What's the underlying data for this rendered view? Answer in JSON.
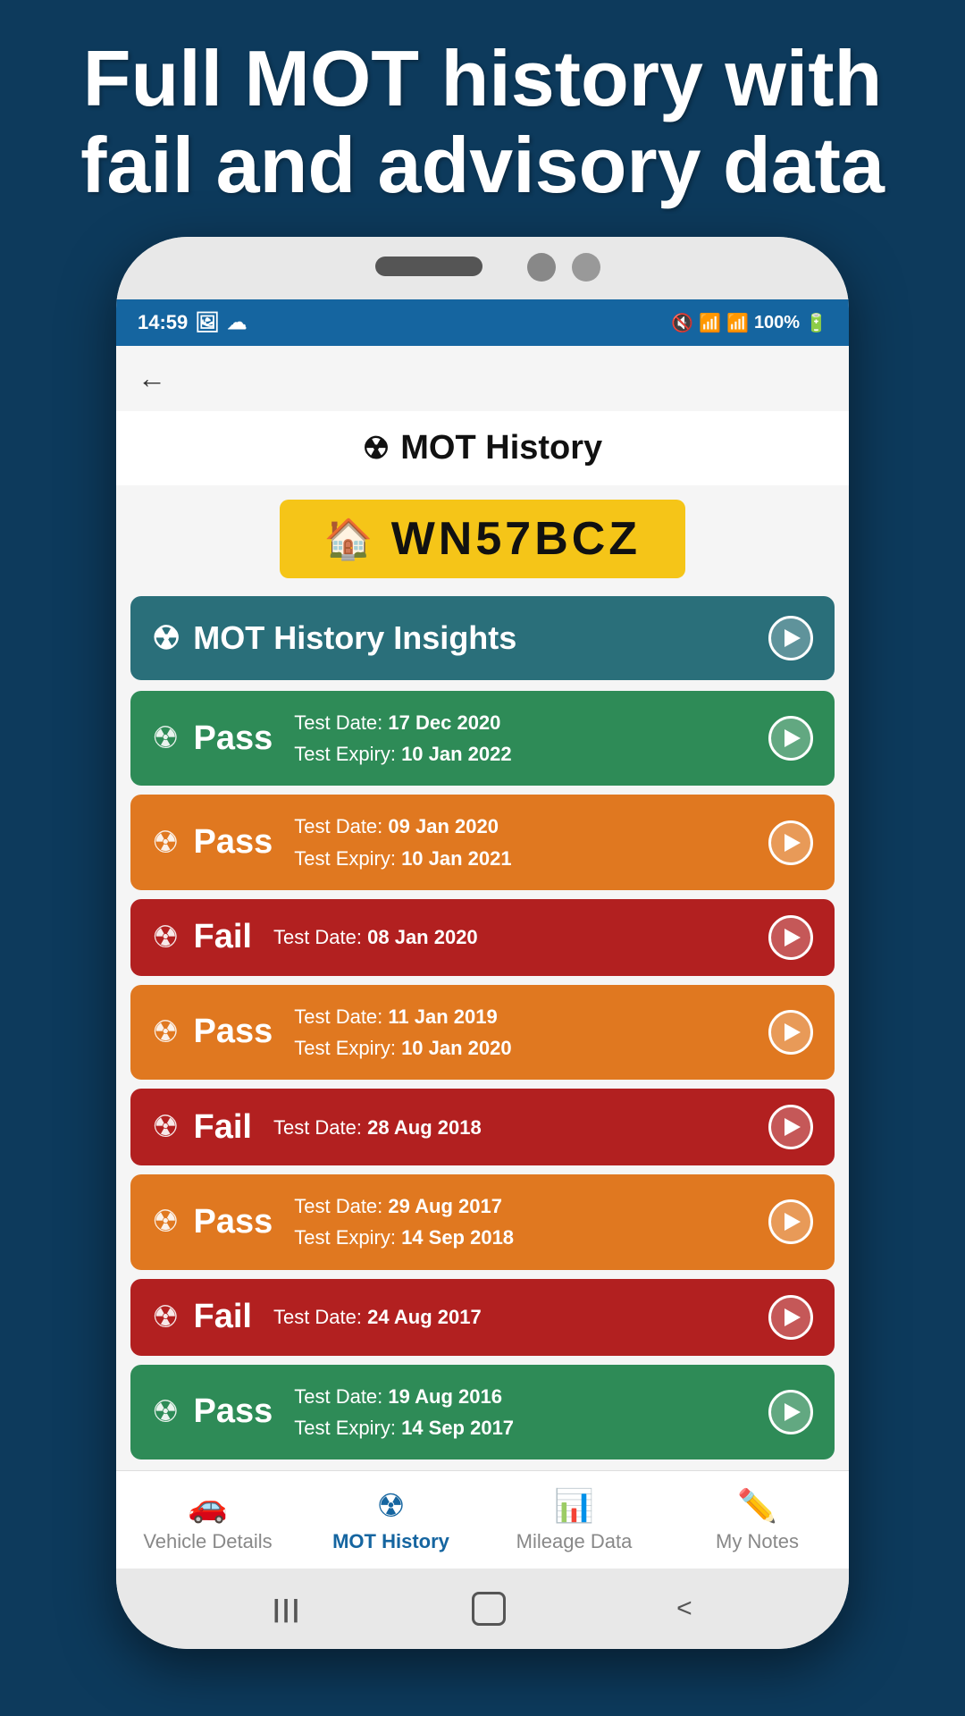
{
  "page": {
    "background_color": "#0d3a5c",
    "header_line1": "Full MOT history with",
    "header_line2": "fail and advisory data"
  },
  "status_bar": {
    "time": "14:59",
    "battery": "100%",
    "signal": "●●●",
    "wifi": "wifi"
  },
  "screen": {
    "title": "MOT History",
    "registration": "WN57BCZ",
    "insights_label": "MOT History Insights",
    "back_label": "←"
  },
  "mot_results": [
    {
      "result": "Pass",
      "color_class": "pass-green",
      "test_date_label": "Test Date:",
      "test_date_value": "17 Dec 2020",
      "expiry_label": "Test Expiry:",
      "expiry_value": "10 Jan 2022",
      "has_expiry": true
    },
    {
      "result": "Pass",
      "color_class": "pass-orange",
      "test_date_label": "Test Date:",
      "test_date_value": "09 Jan 2020",
      "expiry_label": "Test Expiry:",
      "expiry_value": "10 Jan 2021",
      "has_expiry": true
    },
    {
      "result": "Fail",
      "color_class": "fail-red",
      "test_date_label": "Test Date:",
      "test_date_value": "08 Jan 2020",
      "has_expiry": false
    },
    {
      "result": "Pass",
      "color_class": "pass-orange",
      "test_date_label": "Test Date:",
      "test_date_value": "11 Jan 2019",
      "expiry_label": "Test Expiry:",
      "expiry_value": "10 Jan 2020",
      "has_expiry": true
    },
    {
      "result": "Fail",
      "color_class": "fail-red",
      "test_date_label": "Test Date:",
      "test_date_value": "28 Aug 2018",
      "has_expiry": false
    },
    {
      "result": "Pass",
      "color_class": "pass-orange",
      "test_date_label": "Test Date:",
      "test_date_value": "29 Aug 2017",
      "expiry_label": "Test Expiry:",
      "expiry_value": "14 Sep 2018",
      "has_expiry": true
    },
    {
      "result": "Fail",
      "color_class": "fail-red",
      "test_date_label": "Test Date:",
      "test_date_value": "24 Aug 2017",
      "has_expiry": false
    },
    {
      "result": "Pass",
      "color_class": "pass-green",
      "test_date_label": "Test Date:",
      "test_date_value": "19 Aug 2016",
      "expiry_label": "Test Expiry:",
      "expiry_value": "14 Sep 2017",
      "has_expiry": true
    }
  ],
  "bottom_nav": [
    {
      "id": "vehicle-details",
      "label": "Vehicle Details",
      "icon": "car",
      "active": false
    },
    {
      "id": "mot-history",
      "label": "MOT History",
      "icon": "radiation",
      "active": true
    },
    {
      "id": "mileage-data",
      "label": "Mileage Data",
      "icon": "chart",
      "active": false
    },
    {
      "id": "my-notes",
      "label": "My Notes",
      "icon": "pencil",
      "active": false
    }
  ]
}
